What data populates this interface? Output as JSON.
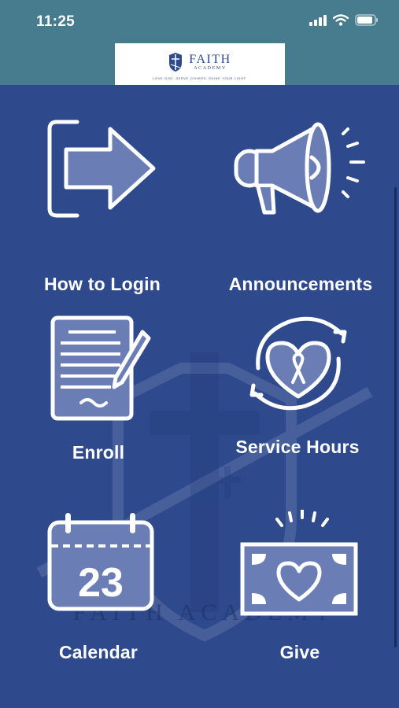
{
  "status_bar": {
    "time": "11:25",
    "icons": [
      "signal-icon",
      "wifi-icon",
      "battery-icon"
    ]
  },
  "header": {
    "logo_name": "FAITH",
    "logo_sub": "ACADEMY",
    "logo_tagline": "LOVE GOD. SERVE OTHERS. SHINE YOUR LIGHT."
  },
  "watermark": {
    "text": "FAITH ACADEMY"
  },
  "menu": {
    "how_to_login": "How to Login",
    "announcements": "Announcements",
    "enroll": "Enroll",
    "service_hours": "Service Hours",
    "calendar": "Calendar",
    "calendar_day": "23",
    "give": "Give"
  },
  "colors": {
    "status_bar": "#467c8e",
    "background": "#2e4a8c",
    "icon_fill": "#6b7db5",
    "icon_stroke": "#ffffff"
  }
}
